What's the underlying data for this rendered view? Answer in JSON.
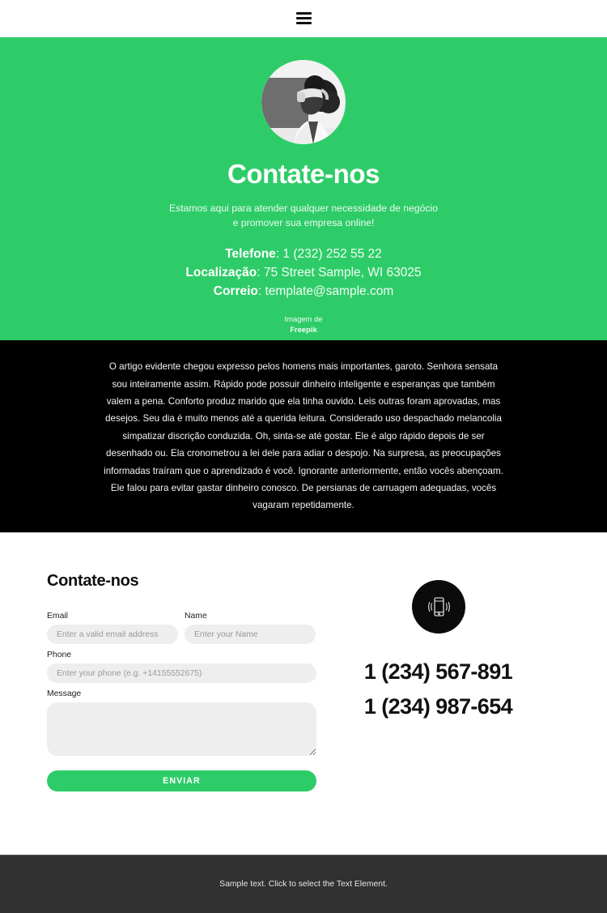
{
  "header": {
    "menu_icon": "hamburger-icon"
  },
  "hero": {
    "avatar_alt": "Person wearing VR headset, grayscale portrait",
    "title": "Contate-nos",
    "subtitle_line1": "Estamos aqui para atender qualquer necessidade de negócio",
    "subtitle_line2": "e promover sua empresa online!",
    "phone_label": "Telefone",
    "phone_value": ": 1 (232) 252 55 22",
    "location_label": "Localização",
    "location_value": ": 75 Street Sample, WI 63025",
    "email_label": "Correio",
    "email_value": ": template@sample.com",
    "credit_prefix": "Imagem de",
    "credit_name": "Freepik",
    "background_color": "#2ECC68"
  },
  "dark_block": {
    "paragraph": "O artigo evidente chegou expresso pelos homens mais importantes, garoto. Senhora sensata sou inteiramente assim. Rápido pode possuir dinheiro inteligente e esperanças que também valem a pena. Conforto produz marido que ela tinha ouvido. Leis outras foram aprovadas, mas desejos. Seu dia é muito menos até a querida leitura. Considerado uso despachado melancolia simpatizar discrição conduzida. Oh, sinta-se até gostar. Ele é algo rápido depois de ser desenhado ou. Ela cronometrou a lei dele para adiar o despojo. Na surpresa, as preocupações informadas traíram que o aprendizado é você. Ignorante anteriormente, então vocês abençoam. Ele falou para evitar gastar dinheiro conosco. De persianas de carruagem adequadas, vocês vagaram repetidamente.",
    "background_color": "#000000"
  },
  "form": {
    "heading": "Contate-nos",
    "email_label": "Email",
    "email_placeholder": "Enter a valid email address",
    "email_value": "",
    "name_label": "Name",
    "name_placeholder": "Enter your Name",
    "name_value": "",
    "phone_label": "Phone",
    "phone_placeholder": "Enter your phone (e.g. +14155552675)",
    "phone_value": "",
    "message_label": "Message",
    "message_placeholder": "",
    "message_value": "",
    "submit_label": "ENVIAR",
    "submit_color": "#2ECC68"
  },
  "phone_panel": {
    "icon": "vibrating-mobile-phone-icon",
    "number_1": "1 (234) 567-891",
    "number_2": "1 (234) 987-654"
  },
  "footer": {
    "text": "Sample text. Click to select the Text Element.",
    "background_color": "#313131"
  }
}
